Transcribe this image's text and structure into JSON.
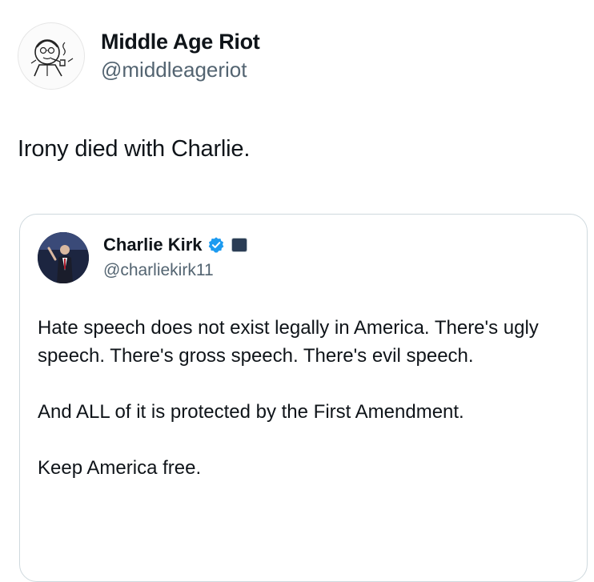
{
  "tweet": {
    "author_name": "Middle Age Riot",
    "author_handle": "@middleageriot",
    "text": "Irony died with Charlie.",
    "avatar_icon": "cartoon-man-with-pipe-avatar"
  },
  "quoted_tweet": {
    "author_name": "Charlie Kirk",
    "author_handle": "@charliekirk11",
    "verified_icon": "verified-badge-icon",
    "affiliate_icon": "affiliate-badge-icon",
    "avatar_icon": "profile-photo-avatar",
    "paragraphs": [
      "Hate speech does not exist legally in America. There's ugly speech. There's gross speech. There's evil speech.",
      "And ALL of it is protected by the First Amendment.",
      "Keep America free."
    ]
  },
  "colors": {
    "text": "#0f1419",
    "secondary_text": "#536471",
    "card_border": "#cfd9de",
    "verified_blue": "#1d9bf0"
  }
}
